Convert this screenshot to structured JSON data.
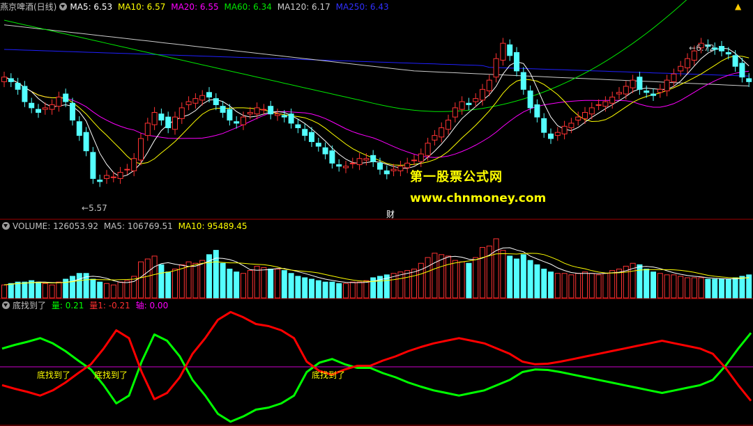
{
  "main_legend": {
    "title": "燕京啤酒(日线)",
    "ma5": "MA5: 6.53",
    "ma10": "MA10: 6.57",
    "ma20": "MA20: 6.55",
    "ma60": "MA60: 6.34",
    "ma120": "MA120: 6.17",
    "ma250": "MA250: 6.43"
  },
  "vol_legend": {
    "title": "VOLUME: 126053.92",
    "ma5": "MA5: 106769.51",
    "ma10": "MA10: 95489.45"
  },
  "ind_legend": {
    "title": "底找到了",
    "q": "量: 0.21",
    "q1": "量1: -0.21",
    "axis": "轴: 0.00"
  },
  "annotations": {
    "high": "6.72",
    "low": "5.57",
    "cai": "财",
    "watermark1": "第一股票公式网",
    "watermark2": "www.chnmoney.com",
    "signal_label": "底找到了"
  },
  "colors": {
    "up": "#ff3232",
    "down": "#54ffff",
    "ma5": "#ffffff",
    "ma10": "#ffff00",
    "ma20": "#ff00ff",
    "ma60": "#00e600",
    "ma120": "#cccccc",
    "ma250": "#2020ff",
    "green_line": "#00ff00",
    "red_line": "#ff0000",
    "axis_line": "#cc00cc",
    "separator": "#a00000"
  },
  "chart_data": [
    {
      "type": "candlestick",
      "title": "燕京啤酒(日线)",
      "ylim": [
        5.5,
        6.8
      ],
      "high_label": 6.72,
      "low_label": 5.57,
      "closes": [
        6.38,
        6.35,
        6.3,
        6.22,
        6.18,
        6.15,
        6.18,
        6.2,
        6.25,
        6.22,
        6.1,
        6.0,
        5.9,
        5.72,
        5.7,
        5.74,
        5.73,
        5.76,
        5.78,
        5.85,
        5.98,
        6.08,
        6.15,
        6.1,
        6.05,
        6.12,
        6.18,
        6.22,
        6.24,
        6.26,
        6.25,
        6.2,
        6.15,
        6.1,
        6.08,
        6.12,
        6.15,
        6.18,
        6.17,
        6.14,
        6.14,
        6.12,
        6.08,
        6.05,
        6.0,
        5.96,
        5.93,
        5.88,
        5.82,
        5.8,
        5.8,
        5.82,
        5.85,
        5.85,
        5.83,
        5.78,
        5.75,
        5.78,
        5.8,
        5.82,
        5.84,
        5.88,
        5.95,
        6.0,
        6.05,
        6.1,
        6.18,
        6.22,
        6.2,
        6.24,
        6.3,
        6.36,
        6.5,
        6.6,
        6.52,
        6.42,
        6.3,
        6.18,
        6.12,
        6.02,
        5.98,
        6.02,
        6.06,
        6.08,
        6.12,
        6.15,
        6.18,
        6.2,
        6.22,
        6.25,
        6.28,
        6.32,
        6.36,
        6.3,
        6.28,
        6.26,
        6.3,
        6.36,
        6.4,
        6.45,
        6.5,
        6.55,
        6.6,
        6.58,
        6.56,
        6.55,
        6.53,
        6.45,
        6.38,
        6.35
      ],
      "ma_series": [
        {
          "name": "MA5",
          "value": 6.53
        },
        {
          "name": "MA10",
          "value": 6.57
        },
        {
          "name": "MA20",
          "value": 6.55
        },
        {
          "name": "MA60",
          "value": 6.34
        },
        {
          "name": "MA120",
          "value": 6.17
        },
        {
          "name": "MA250",
          "value": 6.43
        }
      ]
    },
    {
      "type": "bar",
      "title": "VOLUME",
      "volume": [
        18,
        20,
        22,
        22,
        24,
        22,
        20,
        18,
        22,
        26,
        30,
        34,
        34,
        26,
        22,
        20,
        18,
        22,
        24,
        30,
        50,
        54,
        58,
        46,
        36,
        40,
        46,
        50,
        48,
        52,
        60,
        66,
        48,
        40,
        36,
        34,
        38,
        44,
        42,
        40,
        40,
        38,
        34,
        30,
        28,
        26,
        24,
        22,
        22,
        20,
        20,
        22,
        22,
        24,
        28,
        30,
        32,
        34,
        36,
        38,
        40,
        48,
        56,
        62,
        60,
        58,
        52,
        50,
        48,
        56,
        70,
        72,
        82,
        66,
        58,
        54,
        60,
        52,
        46,
        40,
        36,
        34,
        34,
        32,
        34,
        36,
        34,
        32,
        34,
        38,
        40,
        44,
        48,
        46,
        40,
        36,
        34,
        32,
        32,
        30,
        28,
        28,
        28,
        26,
        26,
        26,
        26,
        28,
        30,
        32
      ],
      "series": [
        {
          "name": "VOLUME",
          "value": 126053.92
        },
        {
          "name": "MA5",
          "value": 106769.51
        },
        {
          "name": "MA10",
          "value": 95489.45
        }
      ]
    },
    {
      "type": "line",
      "title": "底找到了",
      "x_count": 60,
      "series": [
        {
          "name": "量",
          "value": 0.21,
          "values": [
            0.35,
            0.42,
            0.48,
            0.55,
            0.45,
            0.3,
            0.12,
            -0.05,
            -0.35,
            -0.7,
            -0.55,
            0.1,
            0.62,
            0.5,
            0.2,
            -0.25,
            -0.55,
            -0.9,
            -1.05,
            -0.95,
            -0.82,
            -0.78,
            -0.7,
            -0.55,
            -0.1,
            0.08,
            0.15,
            0.05,
            -0.02,
            -0.02,
            -0.12,
            -0.2,
            -0.3,
            -0.38,
            -0.45,
            -0.5,
            -0.55,
            -0.5,
            -0.45,
            -0.35,
            -0.25,
            -0.1,
            -0.05,
            -0.06,
            -0.1,
            -0.15,
            -0.2,
            -0.25,
            -0.3,
            -0.35,
            -0.4,
            -0.45,
            -0.5,
            -0.45,
            -0.4,
            -0.35,
            -0.25,
            0.02,
            0.35,
            0.65
          ]
        },
        {
          "name": "量1",
          "value": -0.21,
          "values": [
            -0.35,
            -0.42,
            -0.48,
            -0.55,
            -0.45,
            -0.3,
            -0.12,
            0.05,
            0.35,
            0.7,
            0.55,
            -0.1,
            -0.62,
            -0.5,
            -0.2,
            0.25,
            0.55,
            0.9,
            1.05,
            0.95,
            0.82,
            0.78,
            0.7,
            0.55,
            0.1,
            -0.08,
            -0.15,
            -0.05,
            0.02,
            0.02,
            0.12,
            0.2,
            0.3,
            0.38,
            0.45,
            0.5,
            0.55,
            0.5,
            0.45,
            0.35,
            0.25,
            0.1,
            0.05,
            0.06,
            0.1,
            0.15,
            0.2,
            0.25,
            0.3,
            0.35,
            0.4,
            0.45,
            0.5,
            0.45,
            0.4,
            0.35,
            0.25,
            -0.02,
            -0.35,
            -0.65
          ]
        },
        {
          "name": "轴",
          "value": 0.0
        }
      ],
      "signal_labels": [
        "底找到了",
        "底找到了",
        "底找到了"
      ]
    }
  ]
}
